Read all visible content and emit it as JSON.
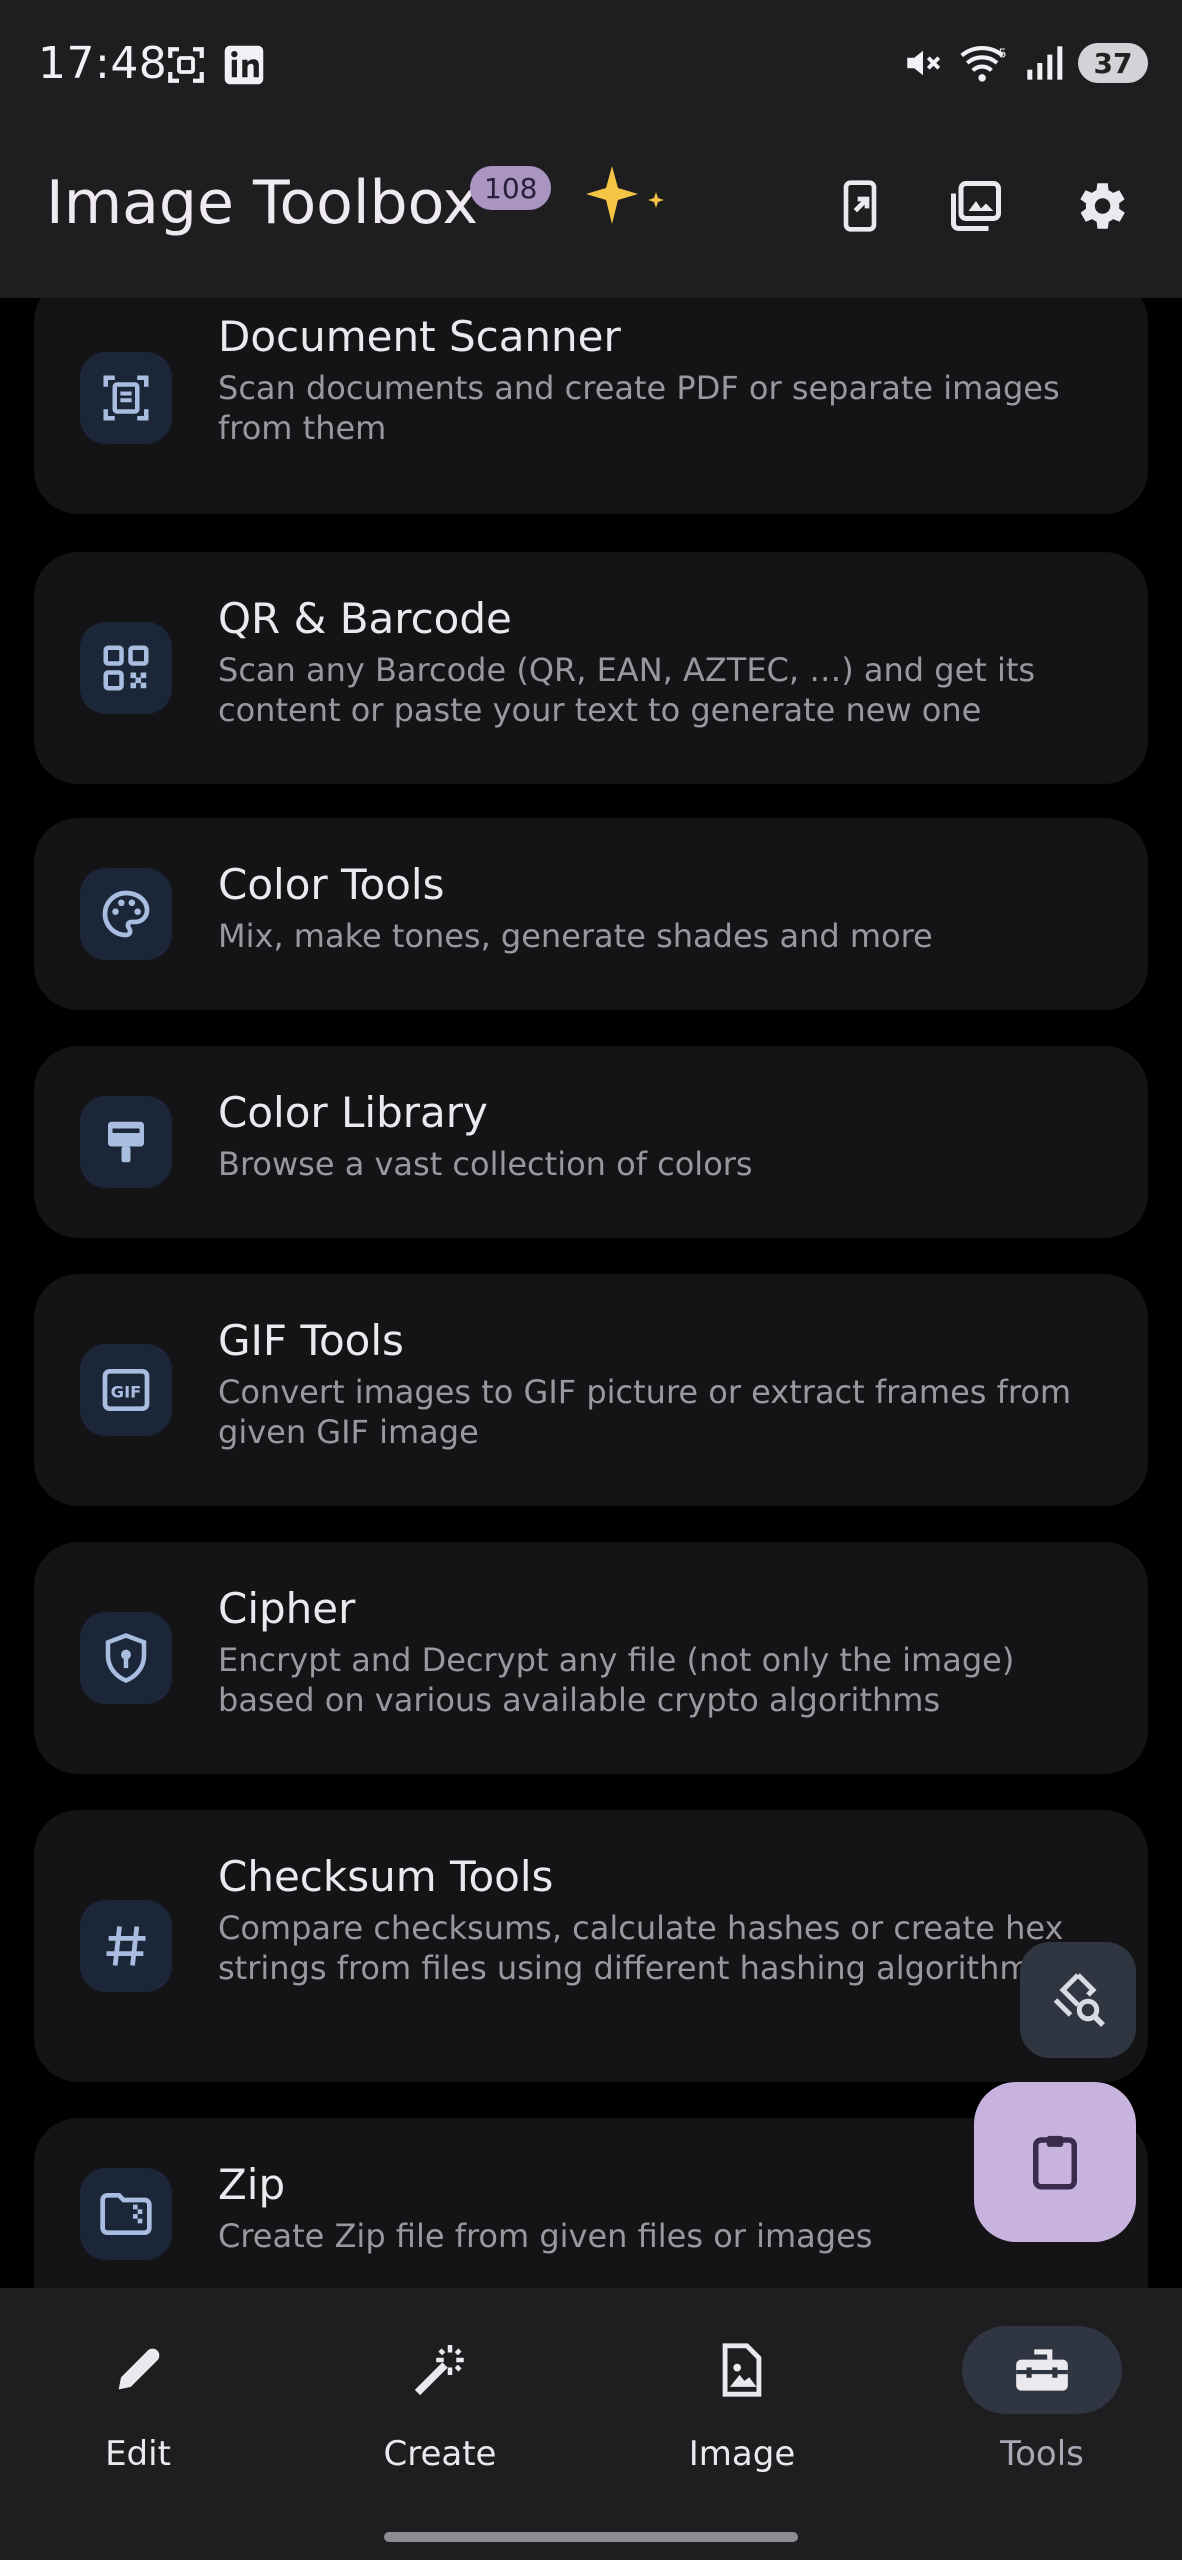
{
  "status_bar": {
    "time": "17:48",
    "battery": "37",
    "wifi_badge": "5"
  },
  "app_bar": {
    "title": "Image Toolbox",
    "badge_count": "108",
    "actions": [
      "shortcut-icon",
      "image-stack-icon",
      "settings-icon"
    ]
  },
  "tools": [
    {
      "title": "Document Scanner",
      "desc": "Scan documents and create PDF or separate images from them",
      "icon": "document-scanner-icon"
    },
    {
      "title": "QR & Barcode",
      "desc": "Scan any Barcode (QR, EAN, AZTEC, …) and get its content or paste your text to generate new one",
      "icon": "qr-code-icon"
    },
    {
      "title": "Color Tools",
      "desc": "Mix, make tones, generate shades and more",
      "icon": "palette-icon"
    },
    {
      "title": "Color Library",
      "desc": "Browse a vast collection of colors",
      "icon": "paint-brush-icon"
    },
    {
      "title": "GIF Tools",
      "desc": "Convert images to GIF picture or extract frames from given GIF image",
      "icon": "gif-icon"
    },
    {
      "title": "Cipher",
      "desc": "Encrypt and Decrypt any file (not only the image) based on various available crypto algorithms",
      "icon": "shield-lock-icon"
    },
    {
      "title": "Checksum Tools",
      "desc": "Compare checksums, calculate hashes or create hex strings from files using different hashing algorithms",
      "icon": "hash-icon"
    },
    {
      "title": "Zip",
      "desc": "Create Zip file from given files or images",
      "icon": "zip-folder-icon"
    }
  ],
  "bottom_nav": [
    {
      "label": "Edit",
      "icon": "edit-pencil-icon",
      "active": false
    },
    {
      "label": "Create",
      "icon": "magic-wand-icon",
      "active": false
    },
    {
      "label": "Image",
      "icon": "image-file-icon",
      "active": false
    },
    {
      "label": "Tools",
      "icon": "toolbox-icon",
      "active": true
    }
  ],
  "colors": {
    "background": "#000000",
    "surface": "#141416",
    "bar": "#1e1e20",
    "accent": "#c8b3de",
    "icon_tint": "#a9bde0"
  }
}
